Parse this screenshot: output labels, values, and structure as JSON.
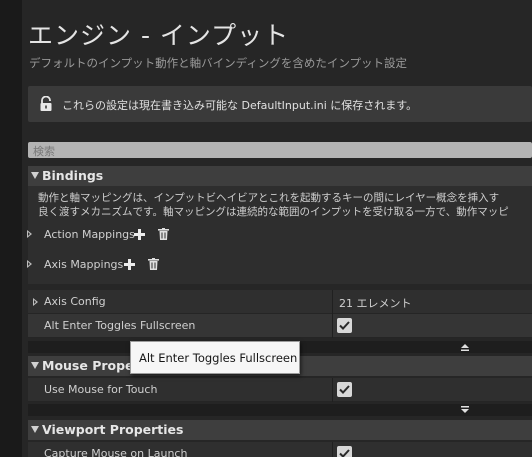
{
  "page": {
    "title": "エンジン - インプット",
    "subtitle": "デフォルトのインプット動作と軸バインディングを含めたインプット設定"
  },
  "notice": {
    "text": "これらの設定は現在書き込み可能な DefaultInput.ini に保存されます。"
  },
  "search": {
    "placeholder": "検索"
  },
  "bindings": {
    "header": "Bindings",
    "description_line1": "動作と軸マッピングは、インプットビヘイビアとこれを起動するキーの間にレイヤー概念を挿入す",
    "description_line2": "良く渡すメカニズムです。軸マッピングは連続的な範囲のインプットを受け取る一方で、動作マッピ",
    "action_mappings": "Action Mappings",
    "axis_mappings": "Axis Mappings",
    "axis_config": "Axis Config",
    "axis_config_value": "21 エレメント",
    "alt_enter": "Alt Enter Toggles Fullscreen",
    "alt_enter_checked": true
  },
  "mouse_properties": {
    "header": "Mouse Propert",
    "use_mouse_for_touch": "Use Mouse for Touch",
    "use_mouse_for_touch_checked": true
  },
  "viewport_properties": {
    "header": "Viewport Properties",
    "capture_mouse": "Capture Mouse on Launch",
    "capture_mouse_checked": true
  },
  "tooltip": {
    "text": "Alt Enter Toggles Fullscreen"
  },
  "icons": {
    "lock": "lock-icon",
    "add": "plus-icon",
    "delete": "trash-icon",
    "collapse": "triangle-up-icon",
    "expand": "triangle-down-icon"
  },
  "colors": {
    "background": "#262626",
    "section_header": "#3e3e3e",
    "row": "#2f2f2f",
    "row_alt": "#353535",
    "search_field": "#b4b4b4",
    "tooltip_bg": "#f6f6f6"
  }
}
